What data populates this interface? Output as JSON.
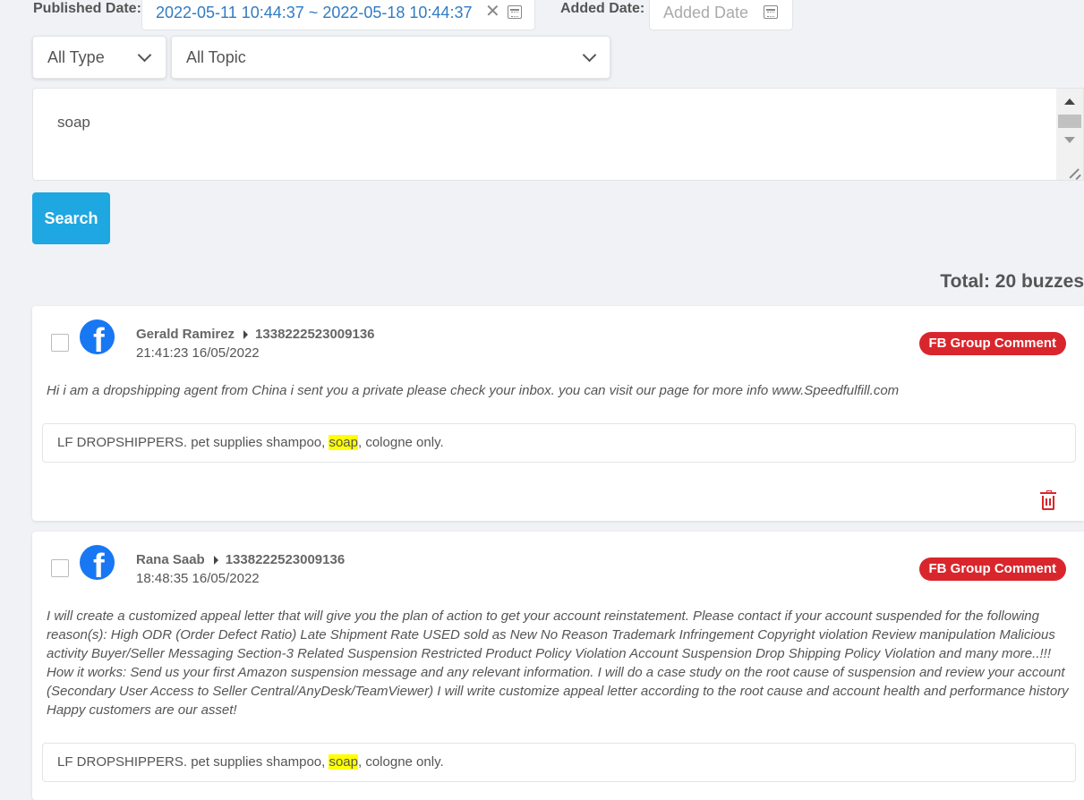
{
  "filters": {
    "published_label": "Published Date:",
    "published_range": "2022-05-11 10:44:37 ~ 2022-05-18 10:44:37",
    "added_label": "Added Date:",
    "added_placeholder": "Added Date",
    "type_select": "All Type",
    "topic_select": "All Topic",
    "keyword": "soap",
    "search_button": "Search"
  },
  "total": "Total: 20 buzzes",
  "results": [
    {
      "author": "Gerald Ramirez",
      "group_id": "1338222523009136",
      "time": "21:41:23 16/05/2022",
      "badge": "FB Group Comment",
      "content": "Hi i am a dropshipping agent from China i sent you a private please check your inbox. you can visit our page for more info www.Speedfulfill.com",
      "post_before": "LF DROPSHIPPERS. pet supplies shampoo, ",
      "post_highlight": "soap",
      "post_after": ", cologne only."
    },
    {
      "author": "Rana Saab",
      "group_id": "1338222523009136",
      "time": "18:48:35 16/05/2022",
      "badge": "FB Group Comment",
      "content": "I will create a customized appeal letter that will give you the plan of action to get your account reinstatement. Please contact if your account suspended for the following reason(s): High ODR (Order Defect Ratio) Late Shipment Rate USED sold as New No Reason Trademark Infringement Copyright violation Review manipulation Malicious activity Buyer/Seller Messaging Section-3 Related Suspension Restricted Product Policy Violation Account Suspension Drop Shipping Policy Violation and many more..!!! How it works: Send us your first Amazon suspension message and any relevant information. I will do a case study on the root cause of suspension and review your account (Secondary User Access to Seller Central/AnyDesk/TeamViewer) I will write customize appeal letter according to the root cause and account health and performance history Happy customers are our asset!",
      "post_before": "LF DROPSHIPPERS. pet supplies shampoo, ",
      "post_highlight": "soap",
      "post_after": ", cologne only."
    }
  ],
  "colors": {
    "accent": "#1ea7e1",
    "badge": "#d9262c",
    "facebook": "#1877f2",
    "highlight": "#ffff00"
  },
  "icons": [
    "clear-icon",
    "calendar-icon",
    "chevron-down-icon",
    "facebook-icon",
    "caret-right-icon",
    "trash-icon"
  ]
}
